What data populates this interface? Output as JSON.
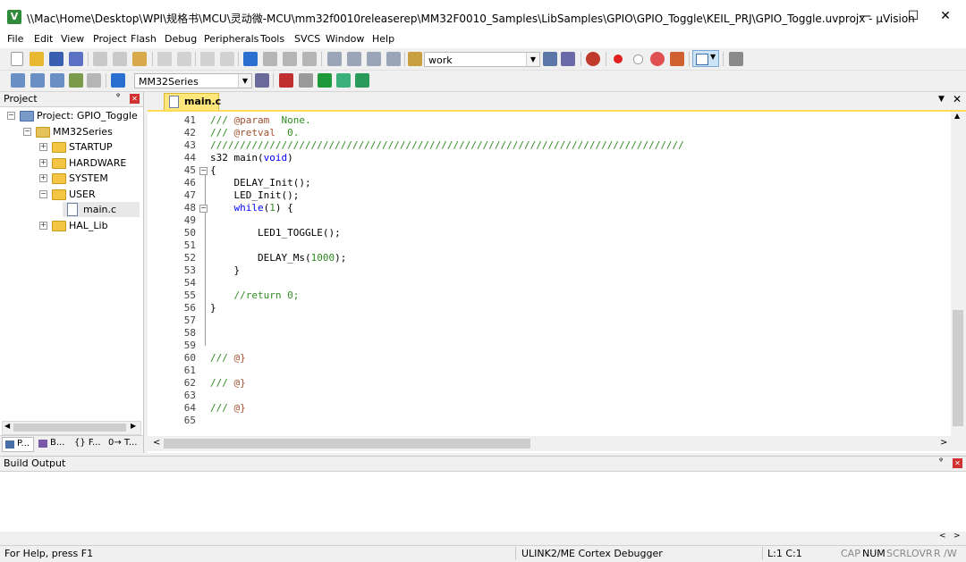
{
  "window": {
    "title": "\\\\Mac\\Home\\Desktop\\WPI\\规格书\\MCU\\灵动微-MCU\\mm32f0010releaserep\\MM32F0010_Samples\\LibSamples\\GPIO\\GPIO_Toggle\\KEIL_PRJ\\GPIO_Toggle.uvprojx - µVision",
    "minimize": "—",
    "maximize": "☐",
    "close": "✕"
  },
  "menu": [
    "File",
    "Edit",
    "View",
    "Project",
    "Flash",
    "Debug",
    "Peripherals",
    "Tools",
    "SVCS",
    "Window",
    "Help"
  ],
  "toolbar": {
    "target_combo": "work",
    "device_combo": "MM32Series"
  },
  "project_panel": {
    "title": "Project",
    "pin": "ᵠ",
    "close": "✕",
    "tree": [
      {
        "label": "Project: GPIO_Toggle",
        "level": 0,
        "expander": "−",
        "icon": "project-icon"
      },
      {
        "label": "MM32Series",
        "level": 1,
        "expander": "−",
        "icon": "target-folder-icon"
      },
      {
        "label": "STARTUP",
        "level": 2,
        "expander": "+",
        "icon": "folder-icon"
      },
      {
        "label": "HARDWARE",
        "level": 2,
        "expander": "+",
        "icon": "folder-icon"
      },
      {
        "label": "SYSTEM",
        "level": 2,
        "expander": "+",
        "icon": "folder-icon"
      },
      {
        "label": "USER",
        "level": 2,
        "expander": "−",
        "icon": "folder-icon"
      },
      {
        "label": "main.c",
        "level": 3,
        "expander": "",
        "icon": "file-icon"
      },
      {
        "label": "HAL_Lib",
        "level": 2,
        "expander": "+",
        "icon": "folder-icon"
      }
    ],
    "bottom_tabs": [
      "P...",
      "B...",
      "{} F...",
      "0→ T..."
    ]
  },
  "editor": {
    "tab": "main.c",
    "lines": [
      {
        "n": "41",
        "code": [
          {
            "t": "/// ",
            "c": "cm"
          },
          {
            "t": "@param",
            "c": "tag"
          },
          {
            "t": "  None.",
            "c": "cm"
          }
        ]
      },
      {
        "n": "42",
        "code": [
          {
            "t": "/// ",
            "c": "cm"
          },
          {
            "t": "@retval",
            "c": "tag"
          },
          {
            "t": "  0.",
            "c": "cm"
          }
        ]
      },
      {
        "n": "43",
        "code": [
          {
            "t": "////////////////////////////////////////////////////////////////////////////////",
            "c": "cm"
          }
        ]
      },
      {
        "n": "44",
        "code": [
          {
            "t": "s32 main(",
            "c": ""
          },
          {
            "t": "void",
            "c": "kw"
          },
          {
            "t": ")",
            "c": ""
          }
        ]
      },
      {
        "n": "45",
        "code": [
          {
            "t": "{",
            "c": ""
          }
        ]
      },
      {
        "n": "46",
        "code": [
          {
            "t": "    DELAY_Init();",
            "c": ""
          }
        ]
      },
      {
        "n": "47",
        "code": [
          {
            "t": "    LED_Init();",
            "c": ""
          }
        ]
      },
      {
        "n": "48",
        "code": [
          {
            "t": "    ",
            "c": ""
          },
          {
            "t": "while",
            "c": "kw"
          },
          {
            "t": "(",
            "c": ""
          },
          {
            "t": "1",
            "c": "num"
          },
          {
            "t": ") {",
            "c": ""
          }
        ]
      },
      {
        "n": "49",
        "code": []
      },
      {
        "n": "50",
        "code": [
          {
            "t": "        LED1_TOGGLE();",
            "c": ""
          }
        ]
      },
      {
        "n": "51",
        "code": []
      },
      {
        "n": "52",
        "code": [
          {
            "t": "        DELAY_Ms(",
            "c": ""
          },
          {
            "t": "1000",
            "c": "num"
          },
          {
            "t": ");",
            "c": ""
          }
        ]
      },
      {
        "n": "53",
        "code": [
          {
            "t": "    }",
            "c": ""
          }
        ]
      },
      {
        "n": "54",
        "code": []
      },
      {
        "n": "55",
        "code": [
          {
            "t": "    //return 0;",
            "c": "cm"
          }
        ]
      },
      {
        "n": "56",
        "code": [
          {
            "t": "}",
            "c": ""
          }
        ]
      },
      {
        "n": "57",
        "code": []
      },
      {
        "n": "58",
        "code": []
      },
      {
        "n": "59",
        "code": []
      },
      {
        "n": "60",
        "code": [
          {
            "t": "/// ",
            "c": "cm"
          },
          {
            "t": "@}",
            "c": "tag"
          }
        ]
      },
      {
        "n": "61",
        "code": []
      },
      {
        "n": "62",
        "code": [
          {
            "t": "/// ",
            "c": "cm"
          },
          {
            "t": "@}",
            "c": "tag"
          }
        ]
      },
      {
        "n": "63",
        "code": []
      },
      {
        "n": "64",
        "code": [
          {
            "t": "/// ",
            "c": "cm"
          },
          {
            "t": "@}",
            "c": "tag"
          }
        ]
      },
      {
        "n": "65",
        "code": []
      }
    ],
    "fold_markers": {
      "45": "−",
      "48": "−"
    }
  },
  "build_output": {
    "title": "Build Output",
    "pin": "ᵠ",
    "close": "✕"
  },
  "status": {
    "help": "For Help, press F1",
    "debugger": "ULINK2/ME Cortex Debugger",
    "position": "L:1 C:1",
    "cap": "CAP",
    "num": "NUM",
    "scrl": "SCRL",
    "ovr": "OVR",
    "rw": "R /W"
  }
}
